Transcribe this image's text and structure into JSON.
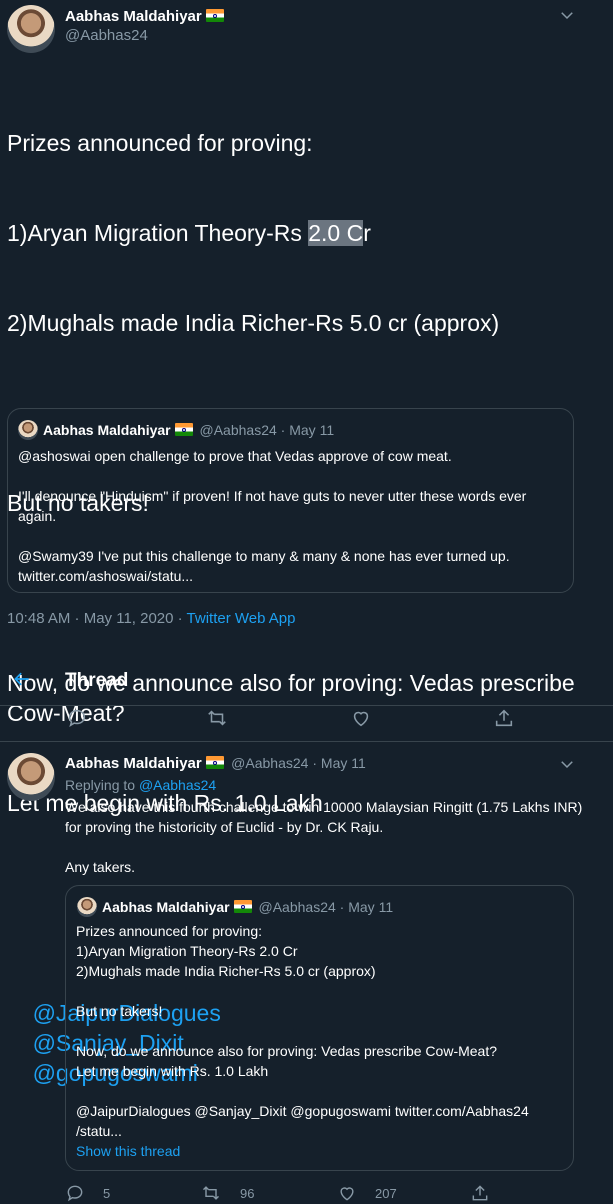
{
  "main_tweet": {
    "author_name": "Aabhas Maldahiyar",
    "author_handle": "@Aabhas24",
    "text_line1": "Prizes announced for proving:",
    "text_line2a": "1)Aryan Migration Theory-Rs ",
    "text_line2_selected": "2.0 C",
    "text_line2b": "r",
    "text_line3": "2)Mughals made India Richer-Rs 5.0 cr (approx)",
    "text_line4": "But no takers!",
    "text_line5": "Now, do we announce also for proving: Vedas prescribe Cow-Meat?",
    "text_line6": "Let me begin with Rs. 1.0 Lakh",
    "mentions": [
      "@JaipurDialogues",
      "@Sanjay_Dixit",
      "@gopugoswami"
    ],
    "quoted": {
      "author_name": "Aabhas Maldahiyar",
      "author_handle": "@Aabhas24",
      "date": "May 11",
      "text": "@ashoswai open challenge to prove that Vedas approve of cow meat.\n\nI'll denounce \"Hinduism\" if proven! If not have guts to never utter these words ever again.\n\n@Swamy39 I've put this challenge to many & many & none has ever turned up.\ntwitter.com/ashoswai/statu..."
    },
    "timestamp": "10:48 AM · May 11, 2020 · ",
    "source": "Twitter Web App"
  },
  "thread_header": {
    "back_icon": "arrow-left-icon",
    "title": "Thread"
  },
  "actions_main": {
    "icons": [
      "reply-icon",
      "retweet-icon",
      "like-icon",
      "share-icon"
    ]
  },
  "reply_tweet": {
    "author_name": "Aabhas Maldahiyar",
    "author_handle": "@Aabhas24",
    "date": "May 11",
    "replying_to_prefix": "Replying to ",
    "replying_to": "@Aabhas24",
    "text": "We also have this fourth challenge to win 10000 Malaysian Ringitt (1.75 Lakhs INR) for proving the historicity of Euclid - by Dr. CK Raju.\n\nAny takers.",
    "quoted": {
      "author_name": "Aabhas Maldahiyar",
      "author_handle": "@Aabhas24",
      "date": "May 11",
      "text": "Prizes announced for proving:\n1)Aryan Migration Theory-Rs 2.0 Cr\n2)Mughals made India Richer-Rs 5.0 cr (approx)\n\nBut no takers!\n\nNow, do we announce also for proving: Vedas prescribe Cow-Meat?\nLet me begin with Rs. 1.0 Lakh\n\n@JaipurDialogues @Sanjay_Dixit @gopugoswami twitter.com/Aabhas24\n/statu...",
      "show_thread": "Show this thread"
    },
    "replies": "5",
    "retweets": "96",
    "likes": "207"
  },
  "colors": {
    "background": "#15202b",
    "border": "#38444d",
    "muted": "#8899a6",
    "link": "#1da1f2"
  }
}
